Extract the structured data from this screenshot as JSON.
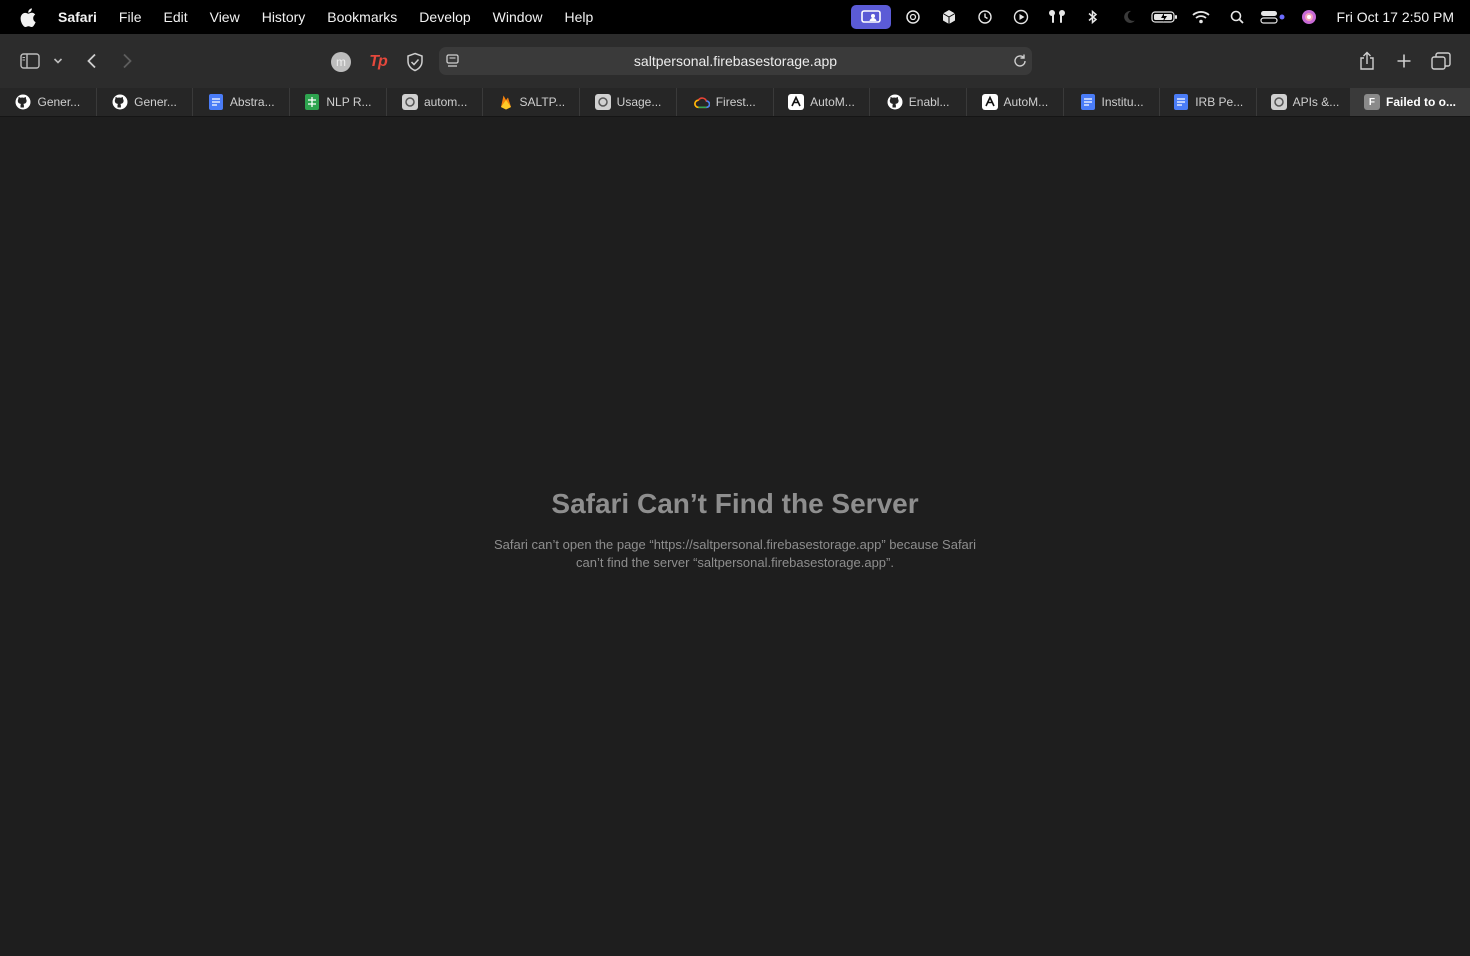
{
  "menubar": {
    "app_name": "Safari",
    "items": [
      "File",
      "Edit",
      "View",
      "History",
      "Bookmarks",
      "Develop",
      "Window",
      "Help"
    ],
    "clock": "Fri Oct 17  2:50 PM",
    "status_icons": [
      "screen-sharing-icon",
      "chatgpt-icon",
      "box-icon",
      "time-machine-icon",
      "play-icon",
      "airpods-icon",
      "bluetooth-icon",
      "moon-icon",
      "battery-icon",
      "wifi-icon",
      "search-icon",
      "control-center-icon",
      "siri-icon"
    ]
  },
  "toolbar": {
    "address": "saltpersonal.firebasestorage.app",
    "extension_avatar_letter": "m",
    "extension_tp_label": "Tp"
  },
  "tabs": [
    {
      "label": "Gener...",
      "icon": "github-icon",
      "color": "#ffffff"
    },
    {
      "label": "Gener...",
      "icon": "github-icon",
      "color": "#ffffff"
    },
    {
      "label": "Abstra...",
      "icon": "google-docs-icon",
      "color": "#4a7cf7"
    },
    {
      "label": "NLP R...",
      "icon": "google-sheets-icon",
      "color": "#2ea44f"
    },
    {
      "label": "autom...",
      "icon": "openai-icon",
      "color": "#d0d0d0"
    },
    {
      "label": "SALTP...",
      "icon": "firebase-icon",
      "color": "#f5820d"
    },
    {
      "label": "Usage...",
      "icon": "openai-icon",
      "color": "#d0d0d0"
    },
    {
      "label": "Firest...",
      "icon": "google-cloud-icon",
      "color": "#4285f4"
    },
    {
      "label": "AutoM...",
      "icon": "anthropic-icon",
      "color": "#ffffff"
    },
    {
      "label": "Enabl...",
      "icon": "github-icon",
      "color": "#ffffff"
    },
    {
      "label": "AutoM...",
      "icon": "anthropic-icon",
      "color": "#ffffff"
    },
    {
      "label": "Institu...",
      "icon": "google-docs-icon",
      "color": "#4a7cf7"
    },
    {
      "label": "IRB Pe...",
      "icon": "google-docs-icon",
      "color": "#4a7cf7"
    },
    {
      "label": "APIs &...",
      "icon": "openai-icon",
      "color": "#d0d0d0"
    },
    {
      "label": "Failed to o...",
      "icon": "letter-f-icon",
      "color": "#8a8a8a",
      "letter": "F",
      "active": true
    }
  ],
  "error": {
    "title": "Safari Can’t Find the Server",
    "message_line1": "Safari can’t open the page “https://saltpersonal.firebasestorage.app” because Safari",
    "message_line2": "can’t find the server “saltpersonal.firebasestorage.app”."
  }
}
